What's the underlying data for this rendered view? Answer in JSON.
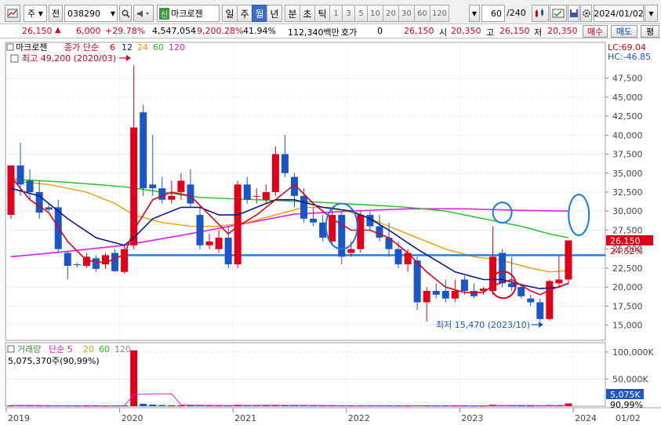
{
  "toolbar": {
    "market": "주",
    "kind": "전",
    "code": "038290",
    "stock_name": "마크로젠",
    "stock_prefix": "신",
    "periods": [
      "일",
      "주",
      "월",
      "년",
      "분",
      "초",
      "틱"
    ],
    "active_period": "월",
    "intervals": [
      "1",
      "3",
      "5",
      "10",
      "20",
      "30",
      "60",
      "120"
    ],
    "count": "60",
    "total": "/240",
    "date": "2024/01/02"
  },
  "quote": {
    "price": "26,150",
    "change": "6,000",
    "change_pct": "+29.78%",
    "volume": "4,547,054",
    "volume_pct": "9,200.28%",
    "turnover": "41.94%",
    "amount": "112,340백만",
    "hoga_label": "호가",
    "hoga_value": "0",
    "hoga_price": "26,150",
    "open_label": "시",
    "open": "20,350",
    "high_label": "고",
    "high": "26,150",
    "low_label": "저",
    "low": "20,350",
    "buy": "매수",
    "sell": "매도",
    "eval": "평"
  },
  "colors": {
    "up": "#e0001a",
    "down": "#1a56c8",
    "ma6": "#e0001a",
    "ma12": "#0a1a8a",
    "ma24": "#e8a000",
    "ma60": "#20c020",
    "ma120": "#e020e0",
    "annotation": "#1a7ae0",
    "hline": "#1a7ae0"
  },
  "chart_data": [
    {
      "type": "candlestick",
      "name": "price",
      "legend": {
        "title": "마크로젠",
        "price_label": "종가 단순",
        "periods": [
          "6",
          "12",
          "24",
          "60",
          "120"
        ]
      },
      "annotations": {
        "high_text": "최고 49,200 (2020/03)",
        "low_text": "최저 15,470 (2023/10)",
        "lc": "LC:69.04",
        "hc": "HC:-46.85",
        "last_price": "26,150",
        "last_pct": "24.52%"
      },
      "ylim": [
        13000,
        52000
      ],
      "yticks": [
        15000,
        17500,
        20000,
        22500,
        25000,
        27500,
        30000,
        32500,
        35000,
        37500,
        40000,
        42500,
        45000,
        47500
      ],
      "ytick_labels": [
        "15,000",
        "17,500",
        "20,000",
        "22,500",
        "25,000",
        "27,500",
        "30,000",
        "32,500",
        "35,000",
        "37,500",
        "40,000",
        "42,500",
        "45,000",
        "47,500"
      ],
      "x_labels": [
        "2019",
        "2020",
        "2021",
        "2022",
        "2023",
        "2024",
        "01/02"
      ],
      "hline": 24200,
      "candles": [
        {
          "o": 29500,
          "h": 31200,
          "l": 29000,
          "c": 36000
        },
        {
          "o": 36000,
          "h": 39000,
          "l": 32000,
          "c": 33500
        },
        {
          "o": 34000,
          "h": 35500,
          "l": 31500,
          "c": 32500
        },
        {
          "o": 32500,
          "h": 34000,
          "l": 29000,
          "c": 29800
        },
        {
          "o": 30500,
          "h": 31000,
          "l": 30000,
          "c": 30200
        },
        {
          "o": 30500,
          "h": 31500,
          "l": 24500,
          "c": 25000
        },
        {
          "o": 24500,
          "h": 24800,
          "l": 21000,
          "c": 22800
        },
        {
          "o": 23000,
          "h": 23200,
          "l": 22600,
          "c": 22900
        },
        {
          "o": 22800,
          "h": 24500,
          "l": 22500,
          "c": 24000
        },
        {
          "o": 23800,
          "h": 24200,
          "l": 22000,
          "c": 22400
        },
        {
          "o": 23000,
          "h": 24500,
          "l": 22400,
          "c": 24200
        },
        {
          "o": 24500,
          "h": 25000,
          "l": 22000,
          "c": 22100
        },
        {
          "o": 22000,
          "h": 25500,
          "l": 21800,
          "c": 25000
        },
        {
          "o": 25500,
          "h": 49200,
          "l": 25000,
          "c": 41000
        },
        {
          "o": 43000,
          "h": 44000,
          "l": 32000,
          "c": 33000
        },
        {
          "o": 33500,
          "h": 40000,
          "l": 32000,
          "c": 33000
        },
        {
          "o": 33000,
          "h": 34500,
          "l": 31000,
          "c": 31500
        },
        {
          "o": 31500,
          "h": 34000,
          "l": 31000,
          "c": 32000
        },
        {
          "o": 32500,
          "h": 35000,
          "l": 31500,
          "c": 34000
        },
        {
          "o": 33500,
          "h": 35500,
          "l": 30500,
          "c": 31000
        },
        {
          "o": 29500,
          "h": 30500,
          "l": 25000,
          "c": 25500
        },
        {
          "o": 25500,
          "h": 27000,
          "l": 25000,
          "c": 26000
        },
        {
          "o": 25000,
          "h": 27500,
          "l": 24500,
          "c": 26500
        },
        {
          "o": 26500,
          "h": 28000,
          "l": 22500,
          "c": 23000
        },
        {
          "o": 23000,
          "h": 34000,
          "l": 22500,
          "c": 33500
        },
        {
          "o": 33500,
          "h": 34500,
          "l": 31000,
          "c": 31500
        },
        {
          "o": 32000,
          "h": 33000,
          "l": 31000,
          "c": 32000
        },
        {
          "o": 31500,
          "h": 33500,
          "l": 31000,
          "c": 32500
        },
        {
          "o": 32500,
          "h": 38500,
          "l": 32000,
          "c": 37500
        },
        {
          "o": 37500,
          "h": 40000,
          "l": 34500,
          "c": 35000
        },
        {
          "o": 34500,
          "h": 35000,
          "l": 30500,
          "c": 32000
        },
        {
          "o": 32000,
          "h": 33000,
          "l": 28500,
          "c": 29000
        },
        {
          "o": 29000,
          "h": 30500,
          "l": 28000,
          "c": 28500
        },
        {
          "o": 28500,
          "h": 29500,
          "l": 26000,
          "c": 26500
        },
        {
          "o": 26000,
          "h": 30500,
          "l": 25500,
          "c": 29500
        },
        {
          "o": 29500,
          "h": 30000,
          "l": 23000,
          "c": 24000
        },
        {
          "o": 24500,
          "h": 26000,
          "l": 24000,
          "c": 25000
        },
        {
          "o": 25000,
          "h": 30000,
          "l": 24500,
          "c": 29500
        },
        {
          "o": 29500,
          "h": 30000,
          "l": 27500,
          "c": 28000
        },
        {
          "o": 28000,
          "h": 29500,
          "l": 26000,
          "c": 26500
        },
        {
          "o": 26500,
          "h": 28500,
          "l": 24000,
          "c": 25000
        },
        {
          "o": 25000,
          "h": 26000,
          "l": 22500,
          "c": 23000
        },
        {
          "o": 23000,
          "h": 25000,
          "l": 22000,
          "c": 24500
        },
        {
          "o": 23500,
          "h": 24000,
          "l": 17000,
          "c": 18000
        },
        {
          "o": 18000,
          "h": 20000,
          "l": 15470,
          "c": 19500
        },
        {
          "o": 19500,
          "h": 20500,
          "l": 18500,
          "c": 19000
        },
        {
          "o": 19500,
          "h": 21000,
          "l": 18000,
          "c": 18500
        },
        {
          "o": 18500,
          "h": 21000,
          "l": 18000,
          "c": 19500
        },
        {
          "o": 21000,
          "h": 21500,
          "l": 19000,
          "c": 19500
        },
        {
          "o": 19500,
          "h": 20500,
          "l": 18500,
          "c": 18800
        },
        {
          "o": 19500,
          "h": 20000,
          "l": 19000,
          "c": 19800
        },
        {
          "o": 19500,
          "h": 28000,
          "l": 19000,
          "c": 24000
        },
        {
          "o": 24500,
          "h": 25000,
          "l": 20000,
          "c": 20500
        },
        {
          "o": 20500,
          "h": 24000,
          "l": 19500,
          "c": 20000
        },
        {
          "o": 20000,
          "h": 20500,
          "l": 18500,
          "c": 18800
        },
        {
          "o": 18500,
          "h": 19000,
          "l": 17500,
          "c": 18000
        },
        {
          "o": 18000,
          "h": 18500,
          "l": 15500,
          "c": 15800
        },
        {
          "o": 15800,
          "h": 21000,
          "l": 15600,
          "c": 20800
        },
        {
          "o": 20500,
          "h": 24200,
          "l": 20000,
          "c": 21000
        },
        {
          "o": 21000,
          "h": 26150,
          "l": 20350,
          "c": 26150
        }
      ],
      "ma": {
        "ma6": [
          [
            0,
            34500
          ],
          [
            2,
            31500
          ],
          [
            4,
            29800
          ],
          [
            6,
            26000
          ],
          [
            8,
            23500
          ],
          [
            10,
            23200
          ],
          [
            12,
            24300
          ],
          [
            13,
            27500
          ],
          [
            15,
            31500
          ],
          [
            17,
            32500
          ],
          [
            19,
            32000
          ],
          [
            21,
            29500
          ],
          [
            23,
            27000
          ],
          [
            24,
            28000
          ],
          [
            26,
            29500
          ],
          [
            28,
            31500
          ],
          [
            30,
            33500
          ],
          [
            32,
            31000
          ],
          [
            34,
            29000
          ],
          [
            36,
            27500
          ],
          [
            38,
            27500
          ],
          [
            40,
            26500
          ],
          [
            42,
            24500
          ],
          [
            44,
            22000
          ],
          [
            46,
            20000
          ],
          [
            48,
            19300
          ],
          [
            50,
            19300
          ],
          [
            51,
            20200
          ],
          [
            53,
            21000
          ],
          [
            55,
            19500
          ],
          [
            56,
            19000
          ],
          [
            57,
            19600
          ],
          [
            59,
            20500
          ]
        ],
        "ma12": [
          [
            0,
            33000
          ],
          [
            3,
            32000
          ],
          [
            6,
            29000
          ],
          [
            9,
            26500
          ],
          [
            12,
            25500
          ],
          [
            13,
            26500
          ],
          [
            15,
            29000
          ],
          [
            18,
            30500
          ],
          [
            20,
            30500
          ],
          [
            22,
            29500
          ],
          [
            24,
            29500
          ],
          [
            26,
            30500
          ],
          [
            28,
            31500
          ],
          [
            30,
            31500
          ],
          [
            33,
            30500
          ],
          [
            36,
            30000
          ],
          [
            38,
            29000
          ],
          [
            40,
            27500
          ],
          [
            43,
            25000
          ],
          [
            45,
            23500
          ],
          [
            47,
            22000
          ],
          [
            50,
            21000
          ],
          [
            52,
            21000
          ],
          [
            54,
            20300
          ],
          [
            56,
            19800
          ],
          [
            58,
            20000
          ],
          [
            59,
            20500
          ]
        ],
        "ma24": [
          [
            0,
            34000
          ],
          [
            4,
            33500
          ],
          [
            8,
            32500
          ],
          [
            11,
            31000
          ],
          [
            13,
            29500
          ],
          [
            16,
            28500
          ],
          [
            19,
            28000
          ],
          [
            22,
            28000
          ],
          [
            25,
            28500
          ],
          [
            28,
            29500
          ],
          [
            31,
            30500
          ],
          [
            34,
            30500
          ],
          [
            37,
            29500
          ],
          [
            40,
            28000
          ],
          [
            43,
            26500
          ],
          [
            46,
            25000
          ],
          [
            49,
            24000
          ],
          [
            52,
            23500
          ],
          [
            55,
            22500
          ],
          [
            57,
            22000
          ],
          [
            59,
            22200
          ]
        ],
        "ma60": [
          [
            0,
            34200
          ],
          [
            6,
            33800
          ],
          [
            12,
            33200
          ],
          [
            16,
            32500
          ],
          [
            20,
            31800
          ],
          [
            26,
            31500
          ],
          [
            32,
            31200
          ],
          [
            38,
            30800
          ],
          [
            42,
            30500
          ],
          [
            46,
            30000
          ],
          [
            50,
            29000
          ],
          [
            54,
            28000
          ],
          [
            57,
            27000
          ],
          [
            59,
            26500
          ]
        ],
        "ma120": [
          [
            0,
            24000
          ],
          [
            6,
            24700
          ],
          [
            12,
            25500
          ],
          [
            18,
            26800
          ],
          [
            24,
            28200
          ],
          [
            30,
            29600
          ],
          [
            36,
            30000
          ],
          [
            42,
            30300
          ],
          [
            48,
            30300
          ],
          [
            54,
            30100
          ],
          [
            59,
            30000
          ]
        ]
      }
    },
    {
      "type": "bar",
      "name": "volume",
      "legend": {
        "title": "거래량",
        "ma_label": "단순 5",
        "periods": [
          "20",
          "60",
          "120"
        ],
        "value_text": "5,075,370주(90,99%)"
      },
      "ylim": [
        0,
        110000
      ],
      "yticks": [
        50000,
        100000
      ],
      "ytick_labels": [
        "50,000K",
        "100,000K"
      ],
      "badge_value": "5,075K",
      "badge_pct": "90,99%",
      "values": [
        1400,
        1600,
        1200,
        1000,
        900,
        1100,
        1200,
        900,
        900,
        800,
        900,
        1000,
        1500,
        103000,
        4500,
        3000,
        2200,
        1800,
        1600,
        1500,
        1400,
        1300,
        1200,
        1200,
        2600,
        1800,
        1500,
        1400,
        2000,
        1700,
        1500,
        1300,
        1200,
        1100,
        1300,
        1200,
        1100,
        1300,
        1200,
        1100,
        1000,
        1000,
        1000,
        1500,
        1200,
        1000,
        900,
        900,
        800,
        800,
        900,
        2700,
        1600,
        1200,
        1000,
        900,
        1400,
        2200,
        1300,
        5075
      ]
    }
  ]
}
